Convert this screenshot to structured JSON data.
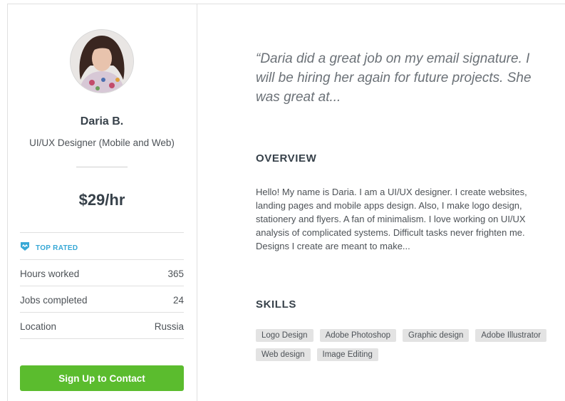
{
  "profile": {
    "name": "Daria B.",
    "title": "UI/UX Designer (Mobile and Web)",
    "rate": "$29/hr",
    "badge": "TOP RATED",
    "stats": [
      {
        "label": "Hours worked",
        "value": "365"
      },
      {
        "label": "Jobs completed",
        "value": "24"
      },
      {
        "label": "Location",
        "value": "Russia"
      }
    ],
    "cta_label": "Sign Up to Contact"
  },
  "quote": "“Daria did a great job on my email signature. I will be hiring her again for future projects. She was great at...",
  "overview": {
    "heading": "OVERVIEW",
    "text": "Hello! My name is Daria. I am a UI/UX designer. I create websites, landing pages and mobile apps design. Also, I make logo design, stationery and flyers. A fan of minimalism. I love working on UI/UX analysis of complicated systems. Difficult tasks never frighten me. Designs I create are meant to make..."
  },
  "skills": {
    "heading": "SKILLS",
    "items": [
      "Logo Design",
      "Adobe Photoshop",
      "Graphic design",
      "Adobe Illustrator",
      "Web design",
      "Image Editing"
    ]
  },
  "colors": {
    "accent_green": "#5bbc2e",
    "badge_blue": "#37a8d6",
    "text_dark": "#37414a"
  },
  "icons": {
    "badge": "top-rated-badge-icon"
  }
}
